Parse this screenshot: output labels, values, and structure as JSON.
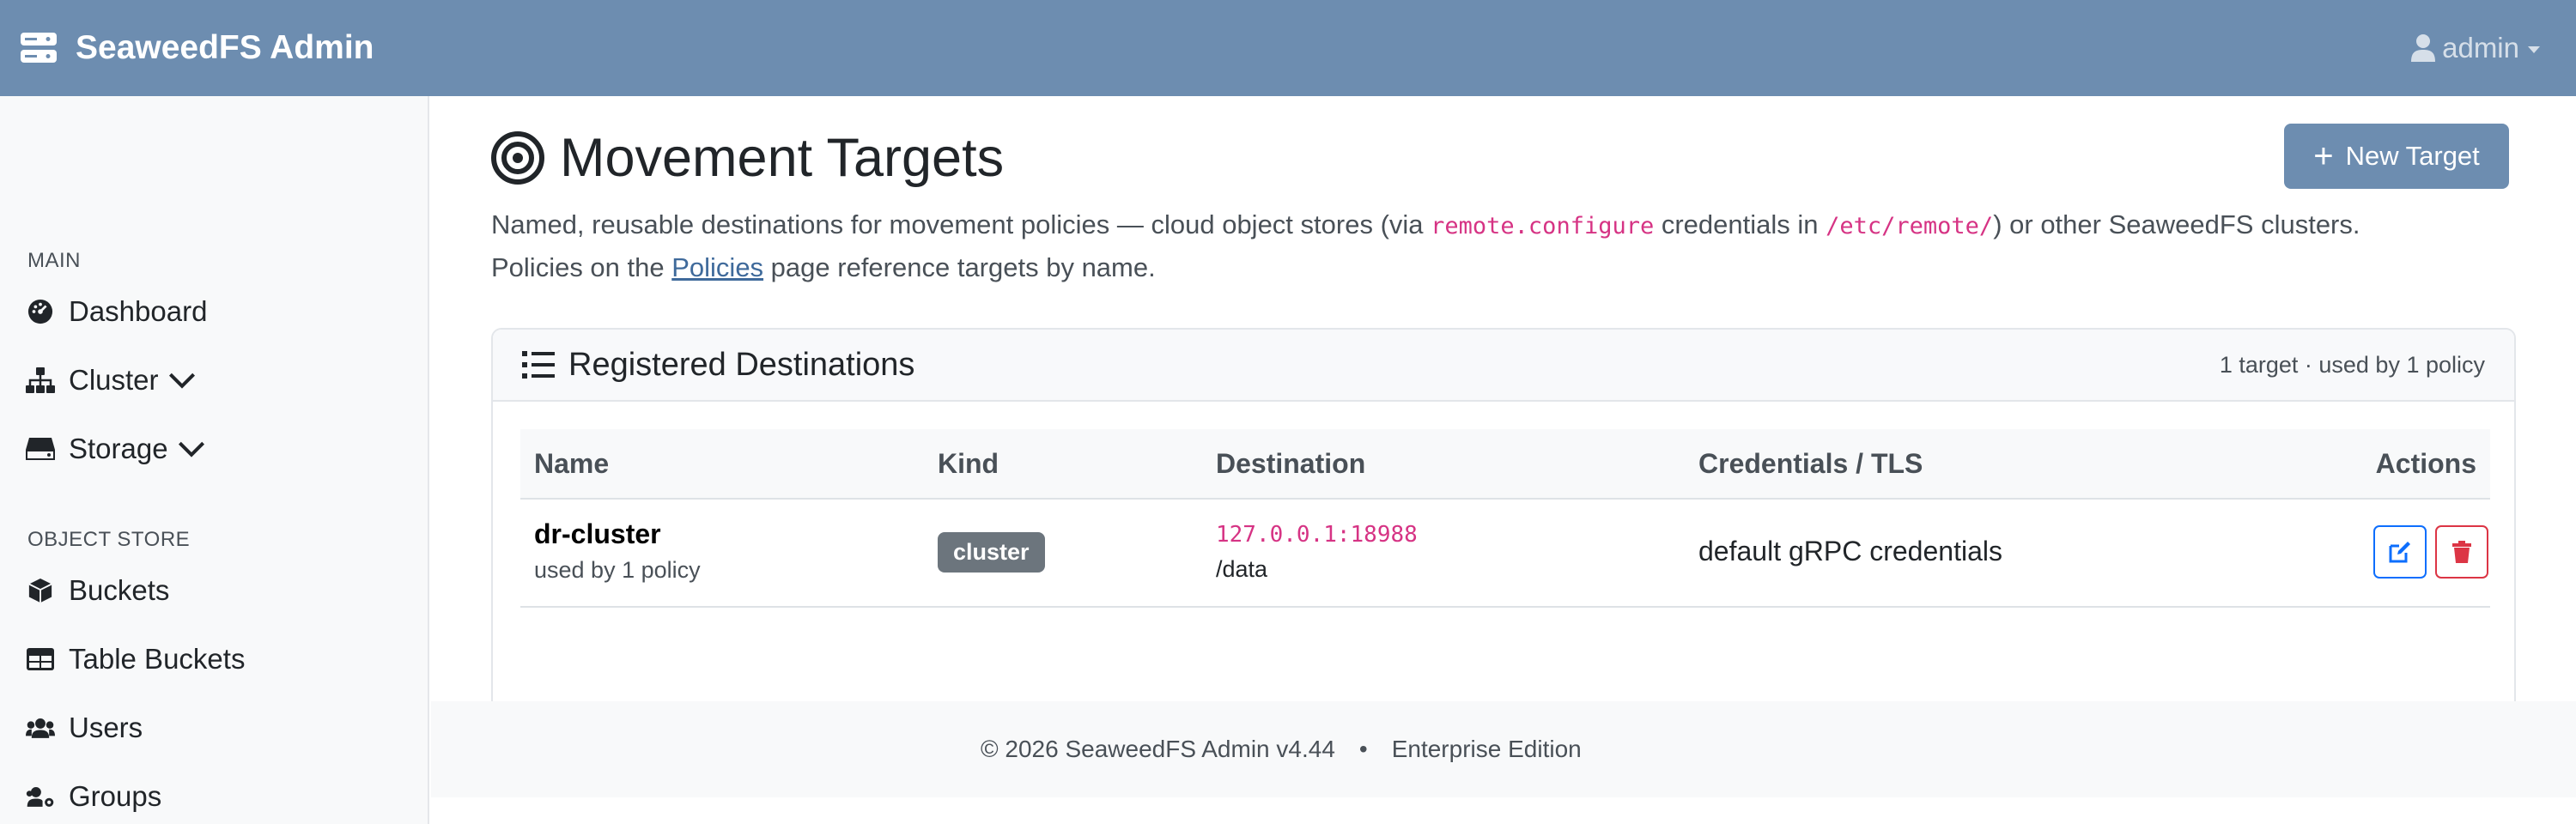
{
  "navbar": {
    "brand": "SeaweedFS Admin",
    "brand_icon": "server-icon",
    "user_label": "admin",
    "user_icon": "user-icon"
  },
  "sidebar": {
    "sections": [
      {
        "title": "MAIN",
        "items": [
          {
            "label": "Dashboard",
            "icon": "dashboard-icon"
          },
          {
            "label": "Cluster",
            "icon": "sitemap-icon",
            "expandable": true
          },
          {
            "label": "Storage",
            "icon": "hdd-icon",
            "expandable": true
          }
        ]
      },
      {
        "title": "OBJECT STORE",
        "items": [
          {
            "label": "Buckets",
            "icon": "cube-icon"
          },
          {
            "label": "Table Buckets",
            "icon": "table-icon"
          },
          {
            "label": "Users",
            "icon": "users-icon"
          },
          {
            "label": "Groups",
            "icon": "users-cog-icon"
          }
        ]
      }
    ]
  },
  "page": {
    "title": "Movement Targets",
    "title_icon": "bullseye-icon",
    "new_button": "New Target",
    "desc": {
      "p1": "Named, reusable destinations for movement policies — cloud object stores (via ",
      "code1": "remote.configure",
      "p2": " credentials in ",
      "code2": "/etc/remote/",
      "p3": ") or other SeaweedFS clusters.",
      "p4": "Policies on the ",
      "link": "Policies",
      "p5": " page reference targets by name."
    }
  },
  "card": {
    "title": "Registered Destinations",
    "title_icon": "list-icon",
    "meta": "1 target · used by 1 policy",
    "columns": [
      "Name",
      "Kind",
      "Destination",
      "Credentials / TLS",
      "Actions"
    ],
    "rows": [
      {
        "name": "dr-cluster",
        "usage": "used by 1 policy",
        "kind": "cluster",
        "destination": "127.0.0.1:18988",
        "path": "/data",
        "credentials": "default gRPC credentials"
      }
    ]
  },
  "footer": {
    "copyright": "© 2026 SeaweedFS Admin v4.44",
    "separator": "•",
    "edition": "Enterprise Edition"
  },
  "colors": {
    "navbar": "#6d8db0",
    "code": "#d63384",
    "edit": "#0d6efd",
    "delete": "#dc3545",
    "badge": "#6c757d"
  }
}
